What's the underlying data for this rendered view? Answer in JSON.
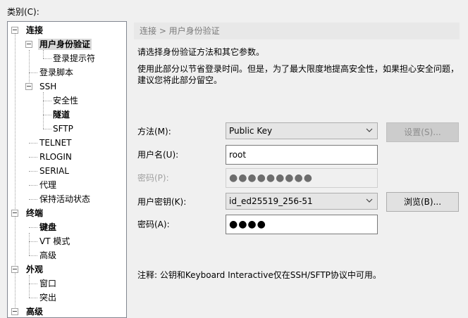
{
  "category_label": "类别(C):",
  "tree": [
    {
      "label": "连接",
      "bold": true
    },
    {
      "label": "用户身份验证",
      "selected": true
    },
    {
      "label": "登录提示符"
    },
    {
      "label": "登录脚本"
    },
    {
      "label": "SSH"
    },
    {
      "label": "安全性"
    },
    {
      "label": "隧道",
      "bold": true
    },
    {
      "label": "SFTP"
    },
    {
      "label": "TELNET"
    },
    {
      "label": "RLOGIN"
    },
    {
      "label": "SERIAL"
    },
    {
      "label": "代理"
    },
    {
      "label": "保持活动状态"
    },
    {
      "label": "终端",
      "bold": true
    },
    {
      "label": "键盘",
      "bold": true
    },
    {
      "label": "VT 模式"
    },
    {
      "label": "高级"
    },
    {
      "label": "外观",
      "bold": true
    },
    {
      "label": "窗口"
    },
    {
      "label": "突出"
    },
    {
      "label": "高级"
    }
  ],
  "breadcrumb": "连接 > 用户身份验证",
  "intro_line": "请选择身份验证方法和其它参数。",
  "desc_line1": "使用此部分以节省登录时间。但是，为了最大限度地提高安全性，如果担心安全问题，",
  "desc_line2": "建议您将此部分留空。",
  "method": {
    "label": "方法(M):",
    "value": "Public Key",
    "settings_button": "设置(S)..."
  },
  "username": {
    "label": "用户名(U):",
    "value": "root"
  },
  "password": {
    "label": "密码(P):",
    "value": "●●●●●●●●●"
  },
  "user_key": {
    "label": "用户密钥(K):",
    "value": "id_ed25519_256-51",
    "browse_button": "浏览(B)..."
  },
  "passphrase": {
    "label": "密码(A):",
    "value": "●●●●"
  },
  "note": "注释: 公钥和Keyboard Interactive仅在SSH/SFTP协议中可用。"
}
